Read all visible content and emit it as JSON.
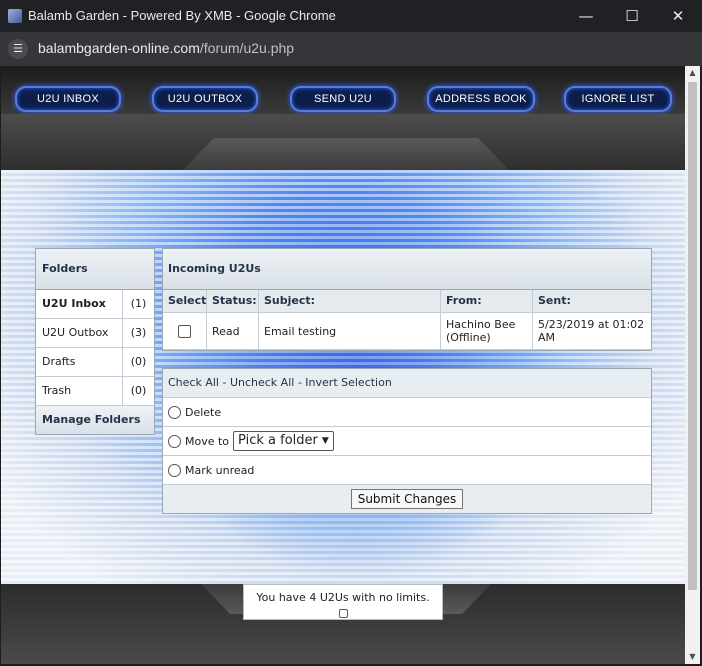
{
  "window": {
    "title": "Balamb Garden - Powered By XMB - Google Chrome",
    "minimize_glyph": "—",
    "maximize_glyph": "☐",
    "close_glyph": "✕"
  },
  "address": {
    "host": "balambgarden-online.com",
    "path": "/forum/u2u.php"
  },
  "nav": {
    "items": [
      "U2U INBOX",
      "U2U OUTBOX",
      "SEND U2U",
      "ADDRESS BOOK",
      "IGNORE LIST"
    ]
  },
  "folders": {
    "title": "Folders",
    "items": [
      {
        "name": "U2U Inbox",
        "count": "(1)"
      },
      {
        "name": "U2U Outbox",
        "count": "(3)"
      },
      {
        "name": "Drafts",
        "count": "(0)"
      },
      {
        "name": "Trash",
        "count": "(0)"
      }
    ],
    "manage_label": "Manage Folders"
  },
  "inbox": {
    "title": "Incoming U2Us",
    "columns": [
      "Select",
      "Status:",
      "Subject:",
      "From:",
      "Sent:"
    ],
    "messages": [
      {
        "status": "Read",
        "subject": "Email testing",
        "from": "Hachino Bee (Offline)",
        "sent": "5/23/2019 at 01:02 AM"
      }
    ]
  },
  "actions": {
    "check_all": "Check All",
    "uncheck_all": "Uncheck All",
    "invert": "Invert Selection",
    "separator": " - ",
    "delete_label": "Delete",
    "move_label": "Move to",
    "folder_select_value": "Pick a folder",
    "mark_unread_label": "Mark unread",
    "submit_label": "Submit Changes"
  },
  "footer": {
    "notice": "You have 4 U2Us with no limits."
  }
}
